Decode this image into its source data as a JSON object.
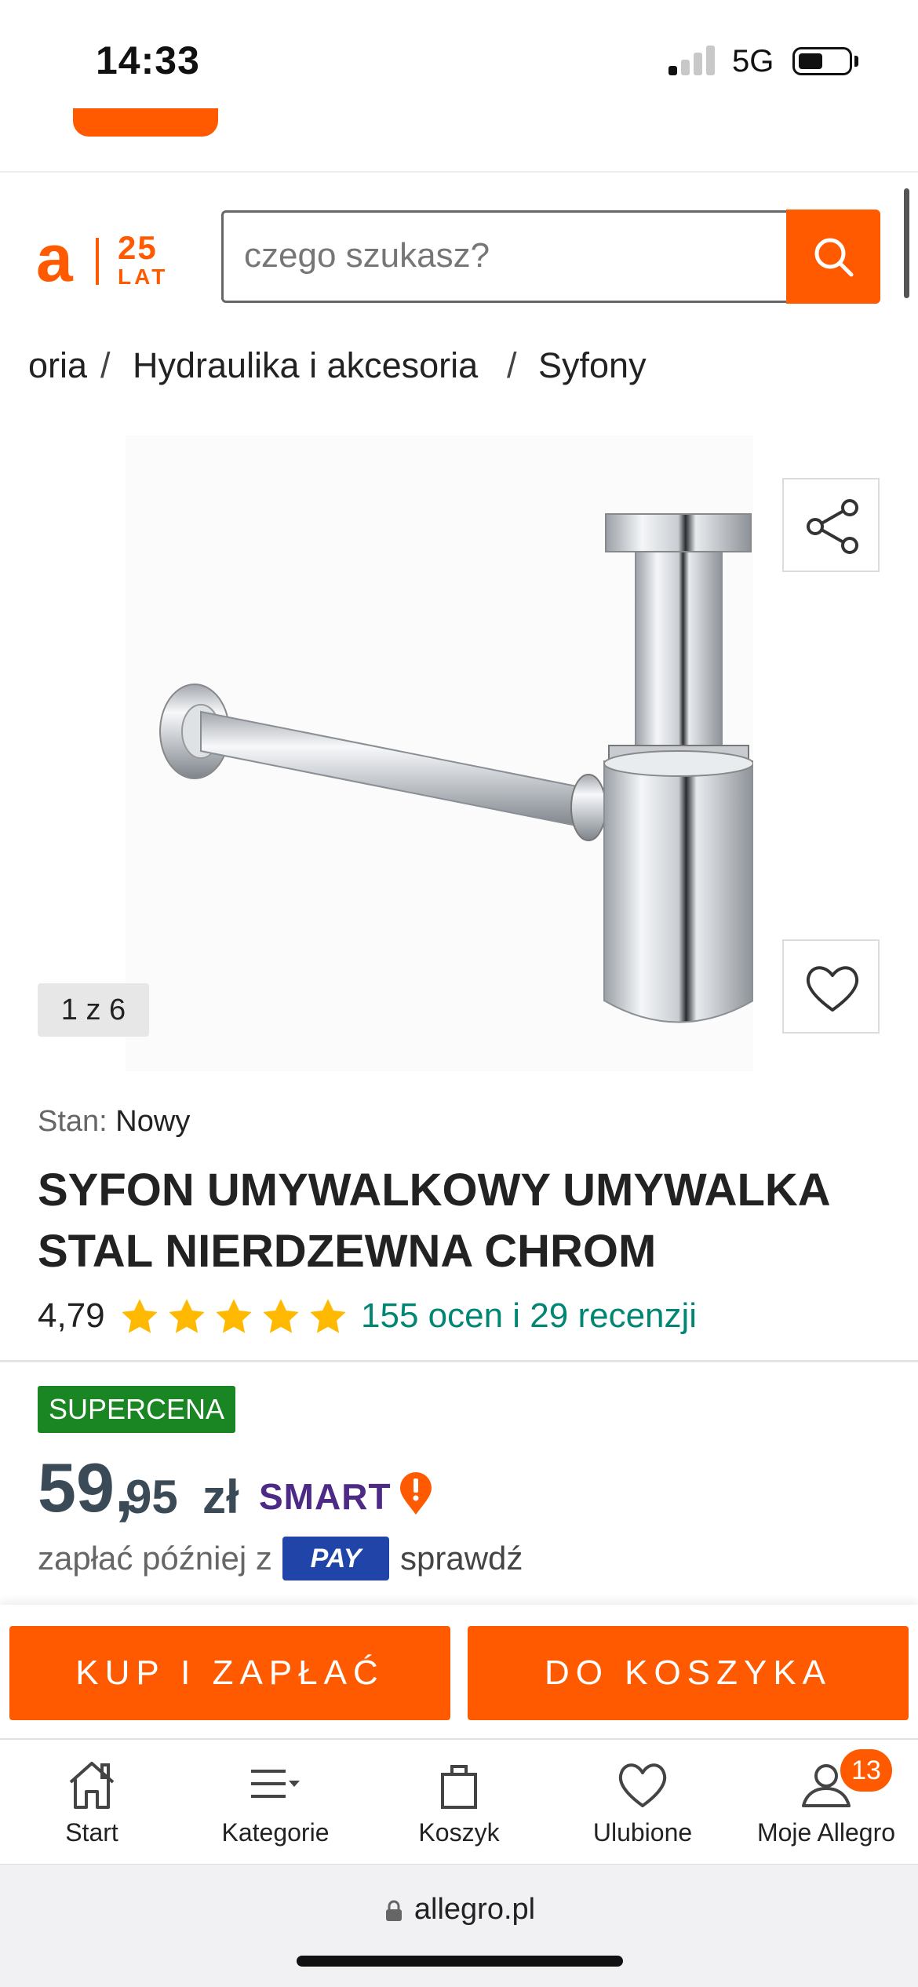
{
  "status_bar": {
    "time": "14:33",
    "network": "5G",
    "signal_bars_active": 1,
    "battery_level": 0.45
  },
  "header": {
    "logo_letter": "a",
    "logo_anniversary_number": "25",
    "logo_anniversary_word": "LAT",
    "search_placeholder": "czego szukasz?",
    "brand_color": "#ff5a00"
  },
  "breadcrumb": [
    "oria",
    "Hydraulika i akcesoria",
    "Syfony"
  ],
  "breadcrumb_separator": "/",
  "gallery": {
    "counter": "1 z 6"
  },
  "product": {
    "condition_label": "Stan:",
    "condition_value": "Nowy",
    "title_line1": "SYFON UMYWALKOWY UMYWALKA",
    "title_line2": "STAL NIERDZEWNA CHROM",
    "rating": "4,79",
    "stars": 5,
    "reviews_link": "155 ocen i 29 recenzji",
    "badge": "SUPERCENA",
    "price_int": "59,",
    "price_dec": "95",
    "currency": "zł",
    "smart_label": "SMART",
    "pay_later_prefix": "zapłać później z",
    "pay_badge": "PAY",
    "pay_later_check": "sprawdź"
  },
  "actions": {
    "buy_label": "KUP I ZAPŁAĆ",
    "cart_label": "DO KOSZYKA"
  },
  "bottom_nav": [
    {
      "label": "Start",
      "icon": "home-icon"
    },
    {
      "label": "Kategorie",
      "icon": "menu-icon"
    },
    {
      "label": "Koszyk",
      "icon": "bag-icon"
    },
    {
      "label": "Ulubione",
      "icon": "heart-icon"
    },
    {
      "label": "Moje Allegro",
      "icon": "user-icon",
      "badge": "13"
    }
  ],
  "url_bar": {
    "url": "allegro.pl"
  },
  "colors": {
    "accent": "#ff5a00",
    "link": "#008673",
    "star": "#ffb900",
    "supercena": "#1a8523",
    "smart": "#4c2a86",
    "pay": "#2044a8"
  }
}
